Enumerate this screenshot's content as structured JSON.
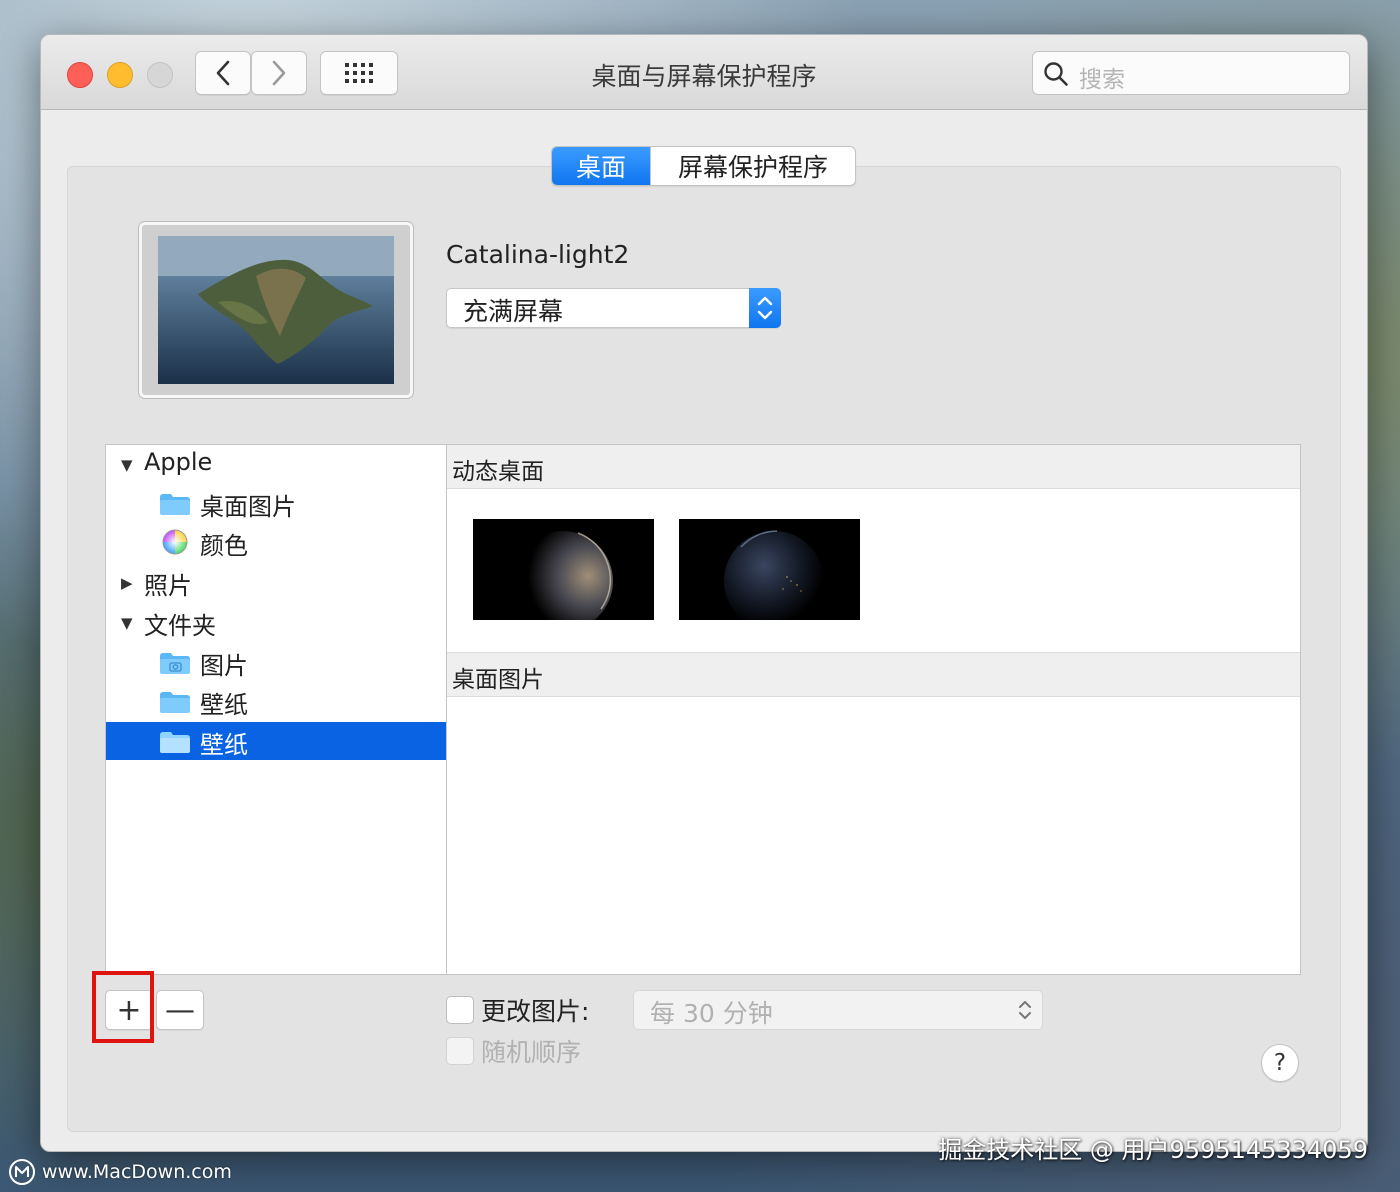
{
  "window": {
    "title": "桌面与屏幕保护程序",
    "search": {
      "placeholder": "搜索",
      "value": ""
    }
  },
  "tabs": [
    {
      "label": "桌面",
      "selected": true
    },
    {
      "label": "屏幕保护程序",
      "selected": false
    }
  ],
  "preview": {
    "name": "Catalina-light2",
    "fit_mode": "充满屏幕"
  },
  "sidebar": {
    "items": [
      {
        "label": "Apple",
        "type": "group",
        "expanded": true
      },
      {
        "label": "桌面图片",
        "type": "folder"
      },
      {
        "label": "颜色",
        "type": "color"
      },
      {
        "label": "照片",
        "type": "group",
        "expanded": false
      },
      {
        "label": "文件夹",
        "type": "group",
        "expanded": true
      },
      {
        "label": "图片",
        "type": "pictures-folder"
      },
      {
        "label": "壁纸",
        "type": "folder"
      },
      {
        "label": "壁纸",
        "type": "folder",
        "selected": true
      }
    ]
  },
  "content": {
    "sections": [
      {
        "title": "动态桌面"
      },
      {
        "title": "桌面图片"
      }
    ]
  },
  "controls": {
    "add_label": "+",
    "remove_label": "—",
    "change_picture_label": "更改图片:",
    "change_interval": "每 30 分钟",
    "random_order_label": "随机顺序",
    "help_label": "?"
  },
  "watermarks": {
    "bottom_right": "掘金技术社区 @ 用户9595145334059",
    "bottom_left": "www.MacDown.com"
  },
  "colors": {
    "accent": "#1076f0",
    "selection": "#0a63e3",
    "highlight_box": "#e0140f"
  }
}
